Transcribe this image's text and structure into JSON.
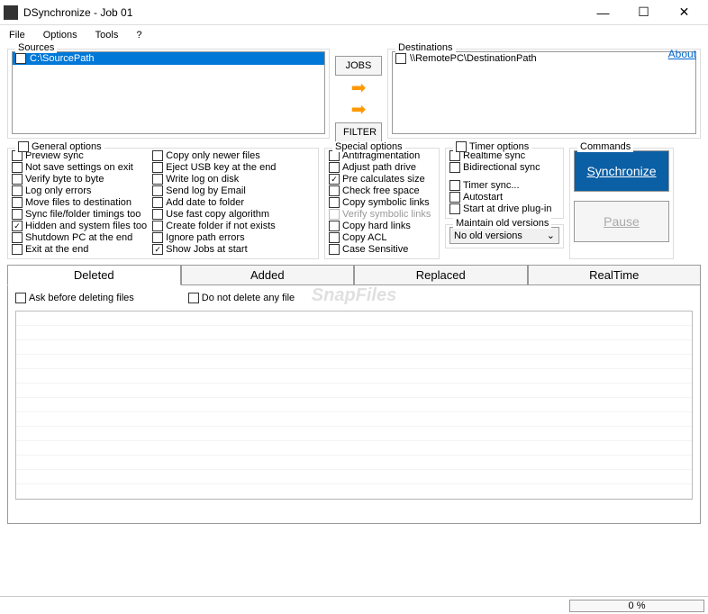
{
  "titlebar": {
    "title": "DSynchronize - Job 01"
  },
  "menubar": {
    "file": "File",
    "options": "Options",
    "tools": "Tools",
    "help": "?"
  },
  "sources": {
    "label": "Sources",
    "items": [
      "C:\\SourcePath"
    ]
  },
  "mid": {
    "jobs": "JOBS",
    "filter": "FILTER"
  },
  "destinations": {
    "label": "Destinations",
    "items": [
      "\\\\RemotePC\\DestinationPath"
    ]
  },
  "about": "About",
  "general": {
    "label": "General options",
    "col1": [
      {
        "label": "Preview sync",
        "checked": false
      },
      {
        "label": "Not save settings on exit",
        "checked": false
      },
      {
        "label": "Verify byte to byte",
        "checked": false
      },
      {
        "label": "Log only errors",
        "checked": false
      },
      {
        "label": "Move files to destination",
        "checked": false
      },
      {
        "label": "Sync file/folder timings too",
        "checked": false
      },
      {
        "label": "Hidden and system files too",
        "checked": true
      },
      {
        "label": "Shutdown PC at the end",
        "checked": false
      },
      {
        "label": "Exit at the end",
        "checked": false
      }
    ],
    "col2": [
      {
        "label": "Copy only newer files",
        "checked": false
      },
      {
        "label": "Eject USB key at the end",
        "checked": false
      },
      {
        "label": "Write log on disk",
        "checked": false
      },
      {
        "label": "Send log by Email",
        "checked": false
      },
      {
        "label": "Add date to folder",
        "checked": false
      },
      {
        "label": "Use fast copy algorithm",
        "checked": false
      },
      {
        "label": "Create folder if not exists",
        "checked": false
      },
      {
        "label": "Ignore path errors",
        "checked": false
      },
      {
        "label": "Show Jobs at start",
        "checked": true
      }
    ]
  },
  "special": {
    "label": "Special options",
    "items": [
      {
        "label": "Antifragmentation",
        "checked": false,
        "disabled": false
      },
      {
        "label": "Adjust path drive",
        "checked": false,
        "disabled": false
      },
      {
        "label": "Pre calculates size",
        "checked": true,
        "disabled": false
      },
      {
        "label": "Check free space",
        "checked": false,
        "disabled": false
      },
      {
        "label": "Copy symbolic links",
        "checked": false,
        "disabled": false
      },
      {
        "label": "Verify symbolic links",
        "checked": false,
        "disabled": true
      },
      {
        "label": "Copy hard links",
        "checked": false,
        "disabled": false
      },
      {
        "label": "Copy ACL",
        "checked": false,
        "disabled": false
      },
      {
        "label": "Case Sensitive",
        "checked": false,
        "disabled": false
      }
    ]
  },
  "timer": {
    "label": "Timer options",
    "items": [
      {
        "label": "Realtime sync",
        "checked": false
      },
      {
        "label": "Bidirectional sync",
        "checked": false
      },
      {
        "label": "Timer sync...",
        "checked": false
      },
      {
        "label": "Autostart",
        "checked": false
      },
      {
        "label": "Start at drive plug-in",
        "checked": false
      }
    ]
  },
  "maintain": {
    "label": "Maintain old versions",
    "selected": "No old versions"
  },
  "commands": {
    "label": "Commands",
    "sync": "Synchronize",
    "pause": "Pause"
  },
  "tabs": {
    "deleted": "Deleted",
    "added": "Added",
    "replaced": "Replaced",
    "realtime": "RealTime"
  },
  "deletedPanel": {
    "ask": "Ask before deleting files",
    "dontdelete": "Do not delete any file"
  },
  "watermark": "SnapFiles",
  "status": {
    "progress": "0 %"
  }
}
